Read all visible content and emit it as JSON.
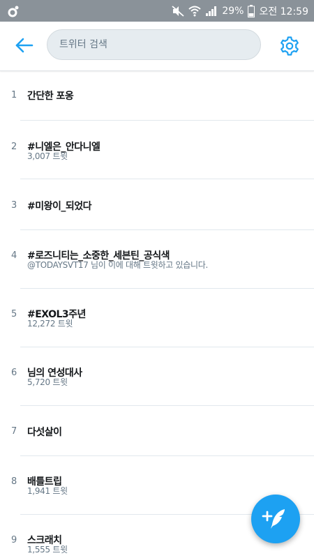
{
  "status_bar": {
    "battery_percent": "29%",
    "time": "오전 12:59"
  },
  "header": {
    "search_placeholder": "트위터 검색"
  },
  "trends": [
    {
      "rank": "1",
      "name": "간단한 포옹",
      "meta": ""
    },
    {
      "rank": "2",
      "name": "#니엘은_안다니엘",
      "meta": "3,007 트윗"
    },
    {
      "rank": "3",
      "name": "#미왕이_되었다",
      "meta": ""
    },
    {
      "rank": "4",
      "name": "#로즈니티는_소중한_세븐틴_공식색",
      "meta": "@TODAYSVT17 님이 이에 대해 트윗하고 있습니다."
    },
    {
      "rank": "5",
      "name": "#EXOL3주년",
      "meta": "12,272 트윗"
    },
    {
      "rank": "6",
      "name": "님의 연성대사",
      "meta": "5,720 트윗"
    },
    {
      "rank": "7",
      "name": "다섯살이",
      "meta": ""
    },
    {
      "rank": "8",
      "name": "배틀트립",
      "meta": "1,941 트윗"
    },
    {
      "rank": "9",
      "name": "스크래치",
      "meta": "1,555 트윗"
    }
  ],
  "colors": {
    "accent": "#1da1f2",
    "status_bar": "#8a9299",
    "search_bg": "#e6ecf0",
    "secondary_text": "#657786"
  },
  "icons": {
    "back": "arrow-left-icon",
    "settings": "gear-icon",
    "compose": "quill-plus-icon"
  }
}
